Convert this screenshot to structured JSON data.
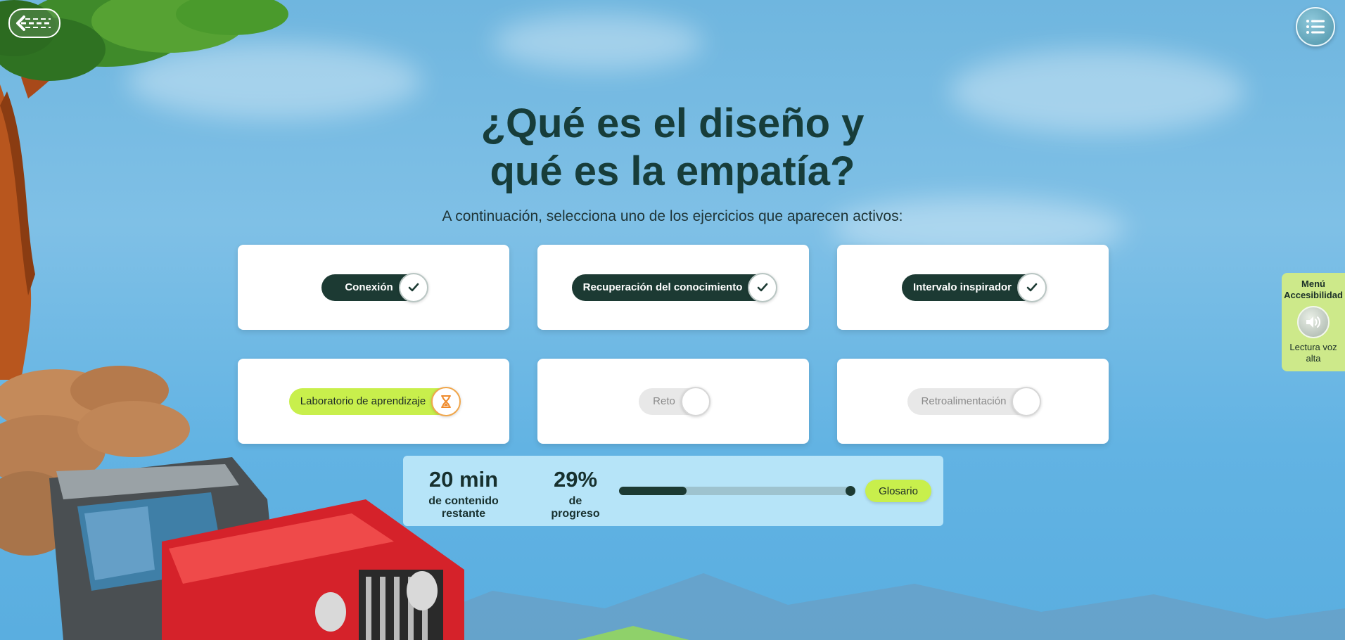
{
  "header": {
    "title_line1": "¿Qué es el diseño y",
    "title_line2": "qué es la empatía?",
    "subtitle": "A continuación, selecciona uno de los ejercicios que aparecen activos:"
  },
  "nav": {
    "back_icon": "back-arrow-icon",
    "menu_icon": "list-menu-icon"
  },
  "exercises": [
    {
      "label": "Conexión",
      "state": "completed",
      "icon": "checkmark-icon"
    },
    {
      "label": "Recuperación del conocimiento",
      "state": "completed",
      "icon": "checkmark-icon"
    },
    {
      "label": "Intervalo inspirador",
      "state": "completed",
      "icon": "checkmark-icon"
    },
    {
      "label": "Laboratorio de aprendizaje",
      "state": "active",
      "icon": "hourglass-icon"
    },
    {
      "label": "Reto",
      "state": "locked",
      "icon": ""
    },
    {
      "label": "Retroalimentación",
      "state": "locked",
      "icon": ""
    }
  ],
  "progress": {
    "time_value": "20 min",
    "time_label": "de contenido restante",
    "percent_value": "29%",
    "percent_label": "de progreso",
    "percent": 29,
    "glossary_label": "Glosario"
  },
  "accessibility": {
    "heading_line1": "Menú",
    "heading_line2": "Accesibilidad",
    "read_aloud_line1": "Lectura voz",
    "read_aloud_line2": "alta",
    "icon": "speaker-icon"
  },
  "colors": {
    "accent_dark": "#1c3a33",
    "accent_lime": "#c8ef4c",
    "title": "#173d3a"
  }
}
